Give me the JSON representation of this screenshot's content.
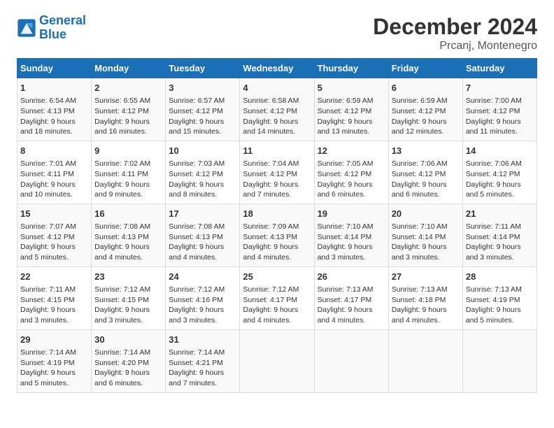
{
  "logo": {
    "line1": "General",
    "line2": "Blue"
  },
  "title": "December 2024",
  "subtitle": "Prcanj, Montenegro",
  "headers": [
    "Sunday",
    "Monday",
    "Tuesday",
    "Wednesday",
    "Thursday",
    "Friday",
    "Saturday"
  ],
  "weeks": [
    [
      {
        "day": "1",
        "sunrise": "6:54 AM",
        "sunset": "4:13 PM",
        "daylight": "9 hours and 18 minutes."
      },
      {
        "day": "2",
        "sunrise": "6:55 AM",
        "sunset": "4:12 PM",
        "daylight": "9 hours and 16 minutes."
      },
      {
        "day": "3",
        "sunrise": "6:57 AM",
        "sunset": "4:12 PM",
        "daylight": "9 hours and 15 minutes."
      },
      {
        "day": "4",
        "sunrise": "6:58 AM",
        "sunset": "4:12 PM",
        "daylight": "9 hours and 14 minutes."
      },
      {
        "day": "5",
        "sunrise": "6:59 AM",
        "sunset": "4:12 PM",
        "daylight": "9 hours and 13 minutes."
      },
      {
        "day": "6",
        "sunrise": "6:59 AM",
        "sunset": "4:12 PM",
        "daylight": "9 hours and 12 minutes."
      },
      {
        "day": "7",
        "sunrise": "7:00 AM",
        "sunset": "4:12 PM",
        "daylight": "9 hours and 11 minutes."
      }
    ],
    [
      {
        "day": "8",
        "sunrise": "7:01 AM",
        "sunset": "4:11 PM",
        "daylight": "9 hours and 10 minutes."
      },
      {
        "day": "9",
        "sunrise": "7:02 AM",
        "sunset": "4:11 PM",
        "daylight": "9 hours and 9 minutes."
      },
      {
        "day": "10",
        "sunrise": "7:03 AM",
        "sunset": "4:12 PM",
        "daylight": "9 hours and 8 minutes."
      },
      {
        "day": "11",
        "sunrise": "7:04 AM",
        "sunset": "4:12 PM",
        "daylight": "9 hours and 7 minutes."
      },
      {
        "day": "12",
        "sunrise": "7:05 AM",
        "sunset": "4:12 PM",
        "daylight": "9 hours and 6 minutes."
      },
      {
        "day": "13",
        "sunrise": "7:06 AM",
        "sunset": "4:12 PM",
        "daylight": "9 hours and 6 minutes."
      },
      {
        "day": "14",
        "sunrise": "7:06 AM",
        "sunset": "4:12 PM",
        "daylight": "9 hours and 5 minutes."
      }
    ],
    [
      {
        "day": "15",
        "sunrise": "7:07 AM",
        "sunset": "4:12 PM",
        "daylight": "9 hours and 5 minutes."
      },
      {
        "day": "16",
        "sunrise": "7:08 AM",
        "sunset": "4:13 PM",
        "daylight": "9 hours and 4 minutes."
      },
      {
        "day": "17",
        "sunrise": "7:08 AM",
        "sunset": "4:13 PM",
        "daylight": "9 hours and 4 minutes."
      },
      {
        "day": "18",
        "sunrise": "7:09 AM",
        "sunset": "4:13 PM",
        "daylight": "9 hours and 4 minutes."
      },
      {
        "day": "19",
        "sunrise": "7:10 AM",
        "sunset": "4:14 PM",
        "daylight": "9 hours and 3 minutes."
      },
      {
        "day": "20",
        "sunrise": "7:10 AM",
        "sunset": "4:14 PM",
        "daylight": "9 hours and 3 minutes."
      },
      {
        "day": "21",
        "sunrise": "7:11 AM",
        "sunset": "4:14 PM",
        "daylight": "9 hours and 3 minutes."
      }
    ],
    [
      {
        "day": "22",
        "sunrise": "7:11 AM",
        "sunset": "4:15 PM",
        "daylight": "9 hours and 3 minutes."
      },
      {
        "day": "23",
        "sunrise": "7:12 AM",
        "sunset": "4:15 PM",
        "daylight": "9 hours and 3 minutes."
      },
      {
        "day": "24",
        "sunrise": "7:12 AM",
        "sunset": "4:16 PM",
        "daylight": "9 hours and 3 minutes."
      },
      {
        "day": "25",
        "sunrise": "7:12 AM",
        "sunset": "4:17 PM",
        "daylight": "9 hours and 4 minutes."
      },
      {
        "day": "26",
        "sunrise": "7:13 AM",
        "sunset": "4:17 PM",
        "daylight": "9 hours and 4 minutes."
      },
      {
        "day": "27",
        "sunrise": "7:13 AM",
        "sunset": "4:18 PM",
        "daylight": "9 hours and 4 minutes."
      },
      {
        "day": "28",
        "sunrise": "7:13 AM",
        "sunset": "4:19 PM",
        "daylight": "9 hours and 5 minutes."
      }
    ],
    [
      {
        "day": "29",
        "sunrise": "7:14 AM",
        "sunset": "4:19 PM",
        "daylight": "9 hours and 5 minutes."
      },
      {
        "day": "30",
        "sunrise": "7:14 AM",
        "sunset": "4:20 PM",
        "daylight": "9 hours and 6 minutes."
      },
      {
        "day": "31",
        "sunrise": "7:14 AM",
        "sunset": "4:21 PM",
        "daylight": "9 hours and 7 minutes."
      },
      null,
      null,
      null,
      null
    ]
  ],
  "labels": {
    "sunrise": "Sunrise:",
    "sunset": "Sunset:",
    "daylight": "Daylight:"
  }
}
